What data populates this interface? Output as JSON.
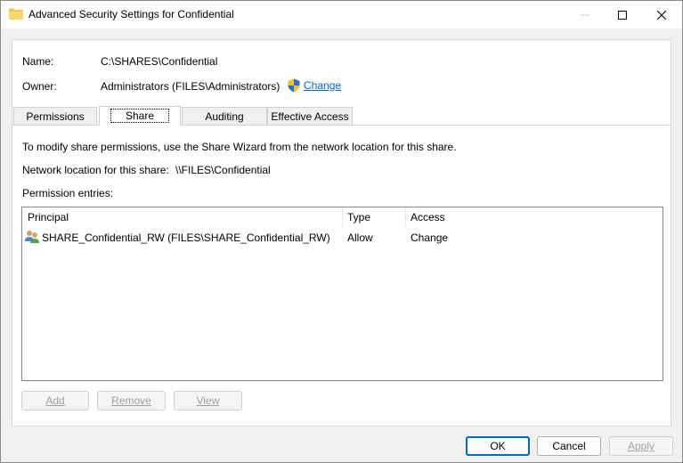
{
  "window": {
    "title": "Advanced Security Settings for Confidential"
  },
  "info": {
    "name_label": "Name:",
    "name_value": "C:\\SHARES\\Confidential",
    "owner_label": "Owner:",
    "owner_value": "Administrators (FILES\\Administrators)",
    "change_link": "Change"
  },
  "tabs": [
    {
      "label": "Permissions",
      "active": false
    },
    {
      "label": "Share",
      "active": true
    },
    {
      "label": "Auditing",
      "active": false
    },
    {
      "label": "Effective Access",
      "active": false
    }
  ],
  "share": {
    "description": "To modify share permissions, use the Share Wizard from the network location for this share.",
    "network_label": "Network location for this share:",
    "network_value": "\\\\FILES\\Confidential",
    "entries_label": "Permission entries:"
  },
  "table": {
    "columns": [
      "Principal",
      "Type",
      "Access"
    ],
    "rows": [
      {
        "principal": "SHARE_Confidential_RW (FILES\\SHARE_Confidential_RW)",
        "type": "Allow",
        "access": "Change"
      }
    ]
  },
  "entry_buttons": {
    "add": "Add",
    "remove": "Remove",
    "view": "View"
  },
  "dialog_buttons": {
    "ok": "OK",
    "cancel": "Cancel",
    "apply": "Apply"
  },
  "colors": {
    "link": "#0066cc",
    "default_button_border": "#0067c0",
    "folder_icon": "#f2c94c"
  }
}
